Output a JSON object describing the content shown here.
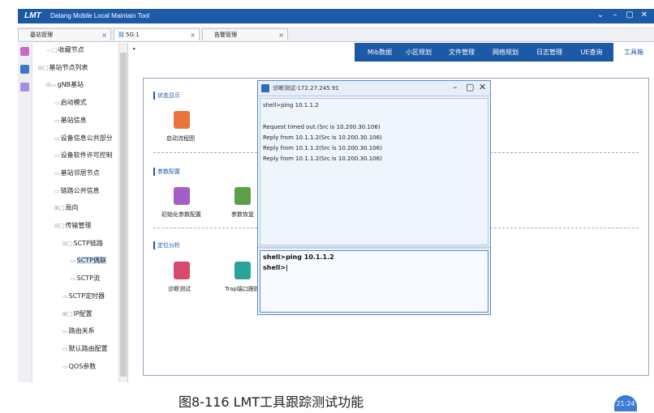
{
  "window": {
    "logo": "LMT",
    "app_title": "Datang Mobile Local Maintain Tool",
    "controls": [
      "⌄",
      "–",
      "▢",
      "✕"
    ]
  },
  "tabs": [
    {
      "label": "基站管理"
    },
    {
      "label": "5G:1"
    },
    {
      "label": "告警管理"
    }
  ],
  "tree": {
    "items": [
      {
        "label": "收藏节点",
        "prefix": "—□"
      },
      {
        "label": "基站节点列表",
        "prefix": "⊟□"
      },
      {
        "label": "gNB基站",
        "prefix": "⊟▭"
      },
      {
        "label": "启动模式",
        "prefix": "▭"
      },
      {
        "label": "基站信息",
        "prefix": "▭"
      },
      {
        "label": "设备信息公共部分",
        "prefix": "▭"
      },
      {
        "label": "设备软件许可控制",
        "prefix": "▭"
      },
      {
        "label": "基站邻居节点",
        "prefix": "▭"
      },
      {
        "label": "链路公共信息",
        "prefix": "▭"
      },
      {
        "label": "局向",
        "prefix": "⊞□"
      },
      {
        "label": "传输管理",
        "prefix": "⊟□"
      },
      {
        "label": "SCTP链路",
        "prefix": "⊟□"
      },
      {
        "label": "SCTP偶联",
        "prefix": "▭"
      },
      {
        "label": "SCTP流",
        "prefix": "▭"
      },
      {
        "label": "SCTP定时器",
        "prefix": "▭"
      },
      {
        "label": "IP配置",
        "prefix": "⊞□"
      },
      {
        "label": "路由关系",
        "prefix": "▭"
      },
      {
        "label": "默认路由配置",
        "prefix": "▭"
      },
      {
        "label": "QOS参数",
        "prefix": "▭"
      }
    ]
  },
  "toolbar": {
    "buttons": [
      "Mib数据",
      "小区规划",
      "文件管理",
      "网络规划",
      "日志管理",
      "UE查询",
      "工具箱"
    ]
  },
  "main": {
    "sections": [
      {
        "title": "状态显示",
        "tools": [
          {
            "label": "启动流程图",
            "icon": "flowchart-icon",
            "color": "#e8743b"
          }
        ]
      },
      {
        "title": "参数配置",
        "tools": [
          {
            "label": "初始化参数配置",
            "icon": "init-config-icon",
            "color": "#a35fc9"
          },
          {
            "label": "参数恢复",
            "icon": "param-restore-icon",
            "color": "#5aa04a"
          }
        ]
      },
      {
        "title": "定位分析",
        "tools": [
          {
            "label": "诊断测试",
            "icon": "diagnose-icon",
            "color": "#d94a6a"
          },
          {
            "label": "Trap端口跟踪",
            "icon": "trap-trace-icon",
            "color": "#2aa39a"
          }
        ]
      }
    ]
  },
  "dialog": {
    "title": "诊断测试-172.27.245.91",
    "controls": [
      "–",
      "▢",
      "✕"
    ],
    "output_lines": [
      "shell>ping 10.1.1.2",
      "",
      "Request timed out.(Src is 10.200.30.106)",
      "Reply from 10.1.1.2(Src is 10.200.30.106)",
      "Reply from 10.1.1.2(Src is 10.200.30.106)",
      "Reply from 10.1.1.2(Src is 10.200.30.106)"
    ],
    "input_lines": [
      "shell>ping  10.1.1.2",
      "shell>|"
    ]
  },
  "caption": "图8-116    LMT工具跟踪测试功能",
  "clock": "21:24",
  "colors": {
    "accent": "#1c5aa8",
    "dialog_border": "#5d8bc4"
  }
}
